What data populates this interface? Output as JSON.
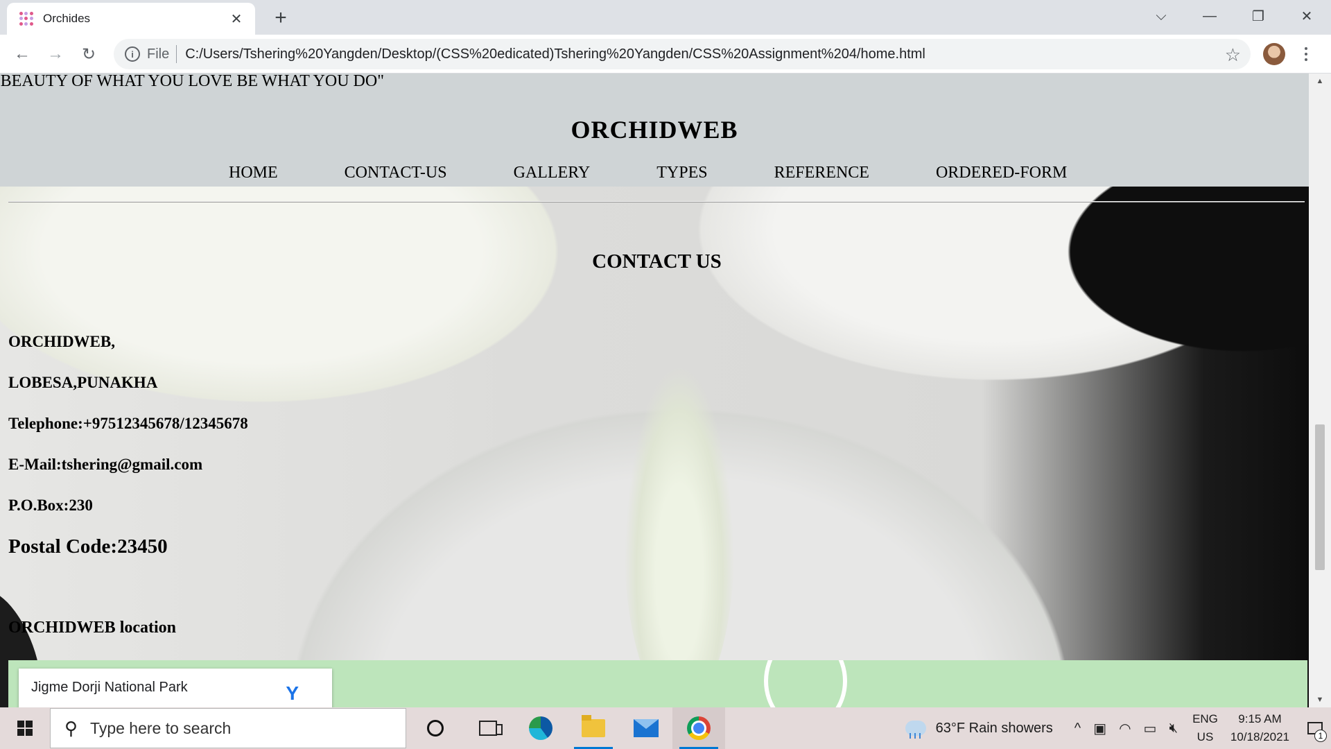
{
  "browser": {
    "tab_title": "Orchides",
    "tab_close": "✕",
    "new_tab": "+",
    "scheme": "File",
    "url": "C:/Users/Tshering%20Yangden/Desktop/(CSS%20edicated)Tshering%20Yangden/CSS%20Assignment%204/home.html"
  },
  "site": {
    "marquee": "E BEAUTY OF WHAT YOU LOVE BE WHAT YOU DO\"",
    "title": "ORCHIDWEB",
    "nav": [
      "HOME",
      "CONTACT-US",
      "GALLERY",
      "TYPES",
      "REFERENCE",
      "ORDERED-FORM"
    ],
    "contact_heading": "CONTACT US",
    "contact_lines": [
      "ORCHIDWEB,",
      "LOBESA,PUNAKHA",
      "Telephone:+97512345678/12345678",
      "E-Mail:tshering@gmail.com",
      "P.O.Box:230"
    ],
    "postal_code": "Postal Code:23450",
    "location_label": "ORCHIDWEB location",
    "map_place": "Jigme Dorji National Park"
  },
  "taskbar": {
    "search_placeholder": "Type here to search",
    "weather": "63°F  Rain showers",
    "lang_top": "ENG",
    "lang_bottom": "US",
    "time": "9:15 AM",
    "date": "10/18/2021",
    "notification_count": "1"
  },
  "colors": {
    "header_band": "#cfd4d6",
    "map_green": "#bde5bb",
    "taskbar": "#e4dada"
  }
}
